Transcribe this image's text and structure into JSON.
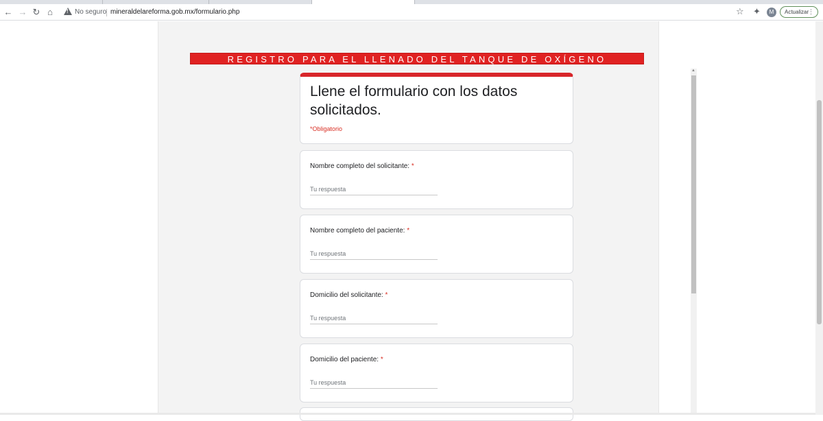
{
  "browser": {
    "security_label": "No seguro",
    "url": "mineraldelareforma.gob.mx/formulario.php",
    "avatar_initial": "M",
    "update_label": "Actualizar",
    "icons": [
      "back-arrow-icon",
      "forward-arrow-icon",
      "reload-icon",
      "home-icon",
      "warning-icon",
      "star-icon",
      "puzzle-icon",
      "more-vert-icon"
    ]
  },
  "banner": {
    "text": "REGISTRO PARA EL LLENADO DEL TANQUE DE OXÍGENO"
  },
  "form": {
    "title": "Llene el formulario con los datos solicitados.",
    "required_note": "*Obligatorio",
    "questions": [
      {
        "label": "Nombre completo del solicitante:",
        "required_mark": "*",
        "placeholder": "Tu respuesta"
      },
      {
        "label": "Nombre completo del paciente:",
        "required_mark": "*",
        "placeholder": "Tu respuesta"
      },
      {
        "label": "Domicilio del solicitante:",
        "required_mark": "*",
        "placeholder": "Tu respuesta"
      },
      {
        "label": "Domicilio del paciente:",
        "required_mark": "*",
        "placeholder": "Tu respuesta"
      }
    ]
  },
  "colors": {
    "banner": "#e02222",
    "accent": "#d8262a",
    "required": "#d93025"
  }
}
